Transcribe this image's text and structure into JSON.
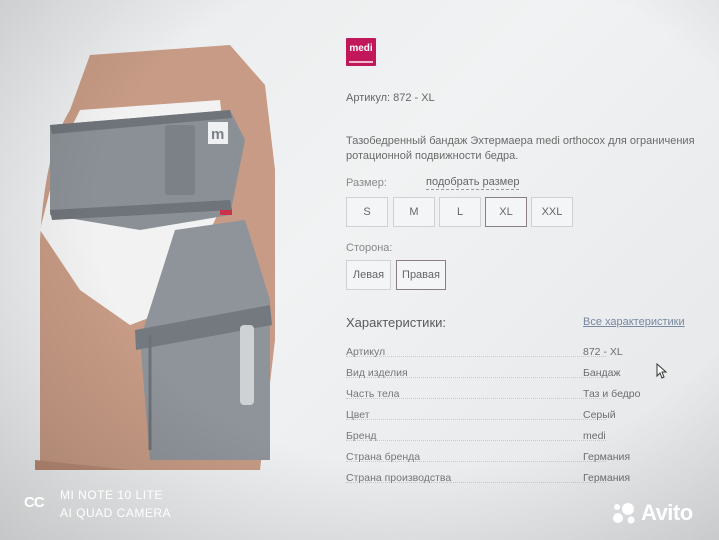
{
  "brand": {
    "logo_text": "medi"
  },
  "product": {
    "sku_label": "Артикул:",
    "sku_value": "872 - XL",
    "description": "Тазобедренный бандаж Эхтермаера medi orthocox для ограничения ротационной подвижности бедра."
  },
  "size": {
    "label": "Размер:",
    "link": "подобрать размер",
    "options": [
      "S",
      "M",
      "L",
      "XL",
      "XXL"
    ],
    "selected": "XL"
  },
  "side": {
    "label": "Сторона:",
    "options": [
      "Левая",
      "Правая"
    ],
    "selected": "Правая"
  },
  "specs": {
    "title": "Характеристики:",
    "all_link": "Все характеристики",
    "rows": [
      {
        "name": "Артикул",
        "value": "872 - XL"
      },
      {
        "name": "Вид изделия",
        "value": "Бандаж"
      },
      {
        "name": "Часть тела",
        "value": "Таз и бедро"
      },
      {
        "name": "Цвет",
        "value": "Серый"
      },
      {
        "name": "Бренд",
        "value": "medi"
      },
      {
        "name": "Страна бренда",
        "value": "Германия"
      },
      {
        "name": "Страна производства",
        "value": "Германия"
      }
    ]
  },
  "overlay": {
    "cc": "CC",
    "model": "MI NOTE 10 LITE",
    "camera": "AI QUAD CAMERA",
    "avito": "Avito"
  },
  "colors": {
    "accent": "#c2185b",
    "link": "#7888a0"
  }
}
